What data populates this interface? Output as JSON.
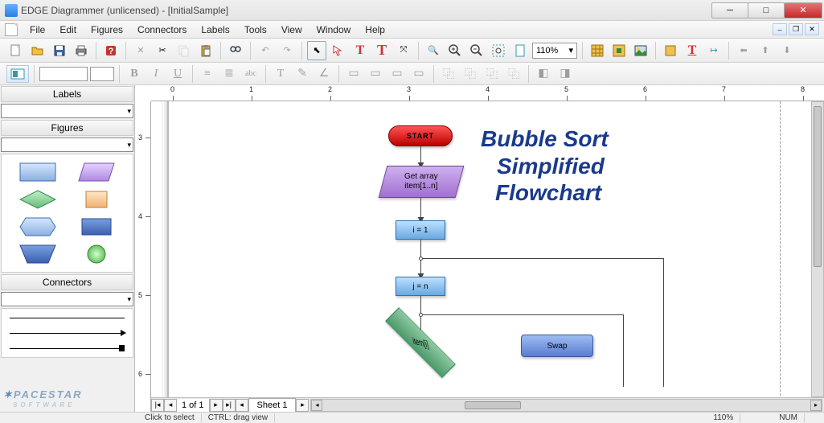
{
  "window": {
    "title": "EDGE Diagrammer (unlicensed) - [InitialSample]"
  },
  "menu": [
    "File",
    "Edit",
    "Figures",
    "Connectors",
    "Labels",
    "Tools",
    "View",
    "Window",
    "Help"
  ],
  "zoom": "110%",
  "sidebar": {
    "labels_header": "Labels",
    "figures_header": "Figures",
    "connectors_header": "Connectors"
  },
  "brand": {
    "name": "PACESTAR",
    "sub": "SOFTWARE"
  },
  "sheet": {
    "page_of": "1 of 1",
    "tab": "Sheet 1"
  },
  "status": {
    "hint": "Click to select",
    "hint2": "CTRL: drag view",
    "zoom": "110%",
    "num": "NUM"
  },
  "flowchart": {
    "title_l1": "Bubble Sort",
    "title_l2": "Simplified",
    "title_l3": "Flowchart",
    "start": "START",
    "getarray_l1": "Get array",
    "getarray_l2": "item[1..n]",
    "i_eq": "i = 1",
    "j_eq": "j = n",
    "cond": "item[i]",
    "swap": "Swap"
  },
  "ruler_h": [
    "0",
    "1",
    "2",
    "3",
    "4",
    "5",
    "6",
    "7",
    "8"
  ],
  "ruler_v": [
    "3",
    "4",
    "5",
    "6"
  ]
}
